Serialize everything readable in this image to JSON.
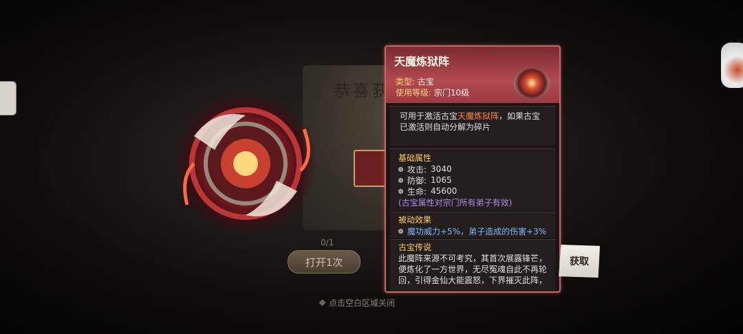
{
  "background": {
    "reward_title": "恭喜获",
    "count": "0/1",
    "open_button": "打开1次",
    "close_hint": "点击空白区域关闭"
  },
  "tooltip": {
    "name": "天魔炼狱阵",
    "type_label": "类型:",
    "type_value": "古宝",
    "level_label": "使用等级:",
    "level_value": "宗门10级",
    "usage_prefix": "可用于激活古宝",
    "usage_highlight": "天魔炼狱阵",
    "usage_suffix": "，如果古宝已激活则自动分解为碎片",
    "base_title": "基础属性",
    "stats": [
      {
        "label": "攻击:",
        "value": "3040"
      },
      {
        "label": "防御:",
        "value": "1065"
      },
      {
        "label": "生命:",
        "value": "45600"
      }
    ],
    "stats_note": "(古宝属性对宗门所有弟子有效)",
    "passive_title": "被动效果",
    "passive_text": "魔功威力+5%，弟子造成的伤害+3%",
    "lore_title": "古宝传说",
    "lore_text": "此魔阵来源不可考究，其首次展露锋芒，便炼化了一方世界，无尽冤魂自此不再轮回，引得金仙大能震怒，下界摧灭此阵，"
  },
  "get_button": "获取",
  "colors": {
    "border": "#c9686a",
    "header": "#b24a50",
    "label_gold": "#ffcf5a",
    "highlight_orange": "#ff8a3c",
    "note_purple": "#b48cf0",
    "passive_blue": "#7fb8ff"
  }
}
